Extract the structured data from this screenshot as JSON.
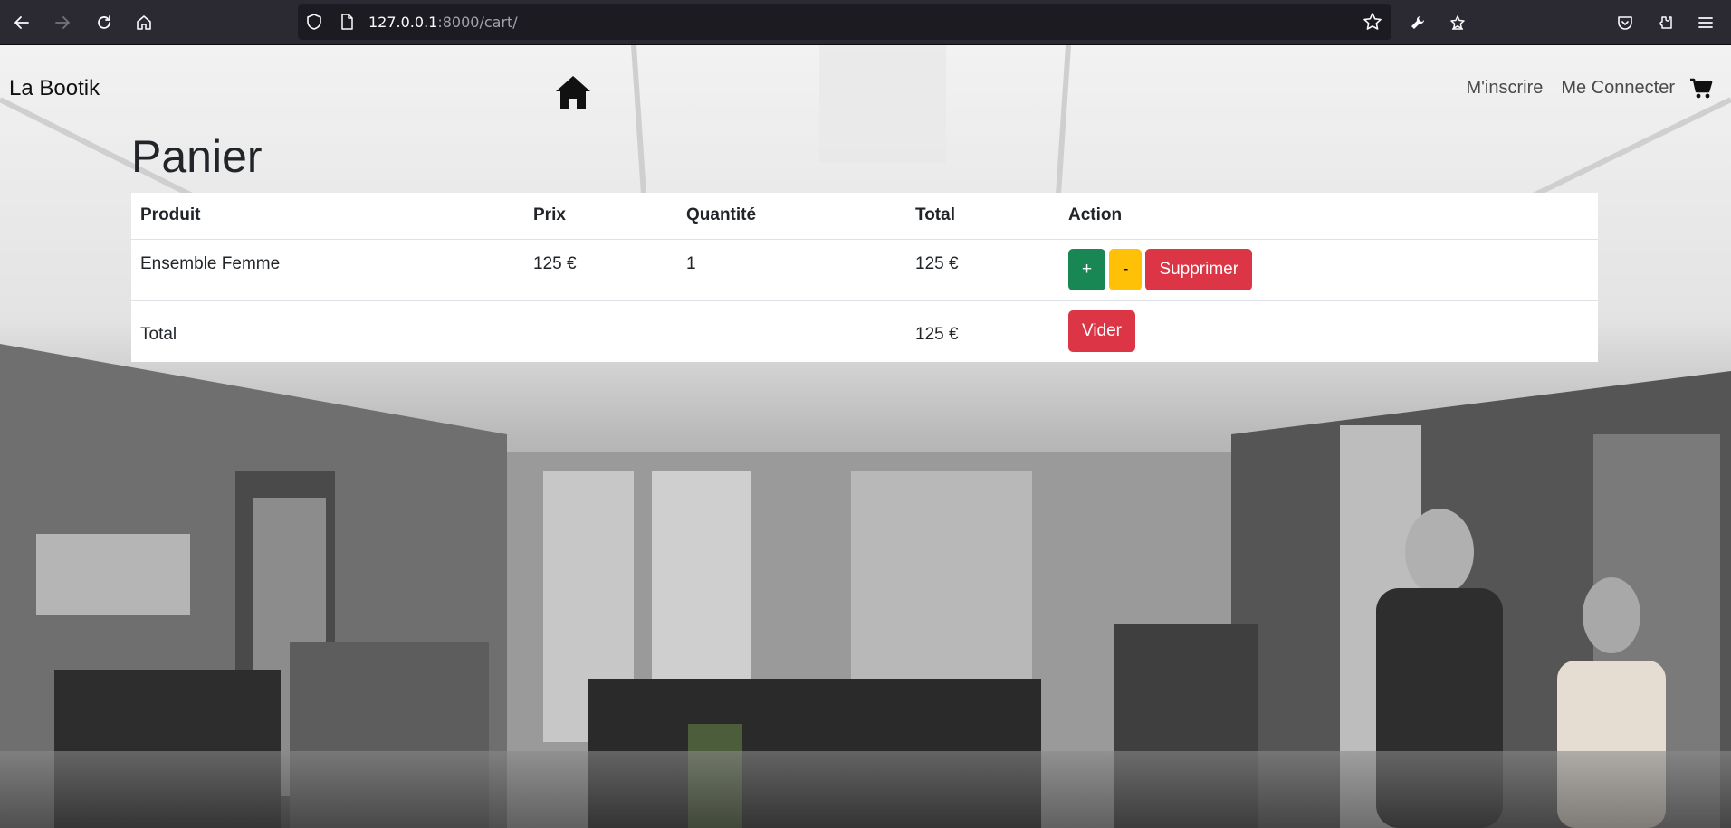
{
  "browser": {
    "url_host": "127.0.0.1",
    "url_path": ":8000/cart/",
    "icons": [
      "back-icon",
      "forward-icon",
      "reload-icon",
      "home-icon",
      "shield-icon",
      "page-icon",
      "bookmark-star-icon",
      "wrench-icon",
      "extension-star-icon",
      "pocket-icon",
      "extensions-icon",
      "menu-icon"
    ]
  },
  "site": {
    "brand": "La Bootik",
    "nav": {
      "signup": "M'inscrire",
      "login": "Me Connecter"
    }
  },
  "page": {
    "title": "Panier"
  },
  "cart": {
    "headers": {
      "product": "Produit",
      "price": "Prix",
      "quantity": "Quantité",
      "total": "Total",
      "action": "Action"
    },
    "items": [
      {
        "product": "Ensemble Femme",
        "price": "125 €",
        "quantity": "1",
        "total": "125 €",
        "buttons": {
          "plus": "+",
          "minus": "-",
          "remove": "Supprimer"
        }
      }
    ],
    "footer": {
      "label": "Total",
      "total": "125 €",
      "clear_button": "Vider"
    }
  },
  "colors": {
    "browser_toolbar": "#2b2a33",
    "url_field": "#1c1b22",
    "btn_success": "#198754",
    "btn_warning": "#ffc107",
    "btn_danger": "#dc3545"
  }
}
